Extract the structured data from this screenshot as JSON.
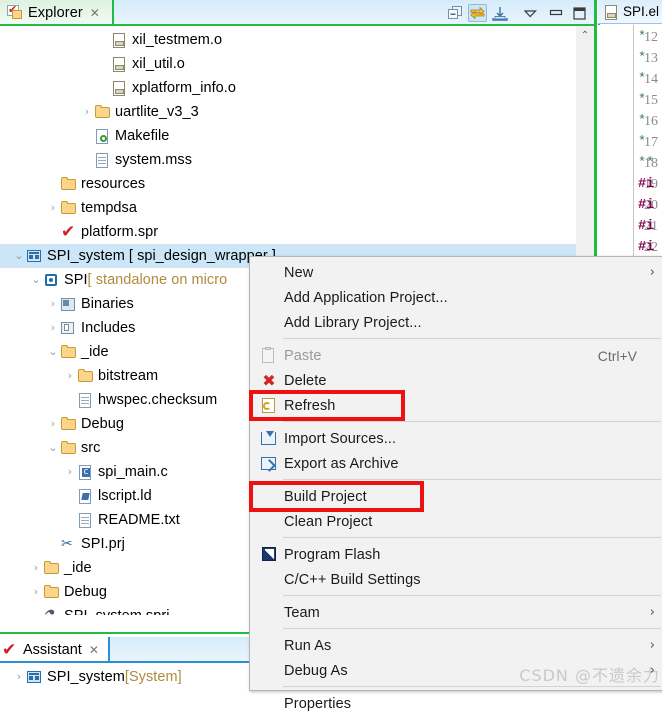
{
  "explorer": {
    "tab_label": "Explorer",
    "tab_close": "✕",
    "tab_icon": "project-explorer-icon",
    "toolbar": [
      {
        "name": "collapse-all-icon",
        "active": false
      },
      {
        "name": "link-with-editor-icon",
        "active": true
      },
      {
        "name": "focus-on-active-task-icon",
        "active": false
      },
      {
        "name": "view-menu-icon",
        "active": false
      },
      {
        "name": "minimize-view-icon",
        "active": false
      },
      {
        "name": "maximize-view-icon",
        "active": false
      }
    ],
    "scroll_up_glyph": "⌃",
    "tree": [
      {
        "label": "xil_testmem.o",
        "indent": 5,
        "arrow": "none",
        "icon": "object-file-icon"
      },
      {
        "label": "xil_util.o",
        "indent": 5,
        "arrow": "none",
        "icon": "object-file-icon"
      },
      {
        "label": "xplatform_info.o",
        "indent": 5,
        "arrow": "none",
        "icon": "object-file-icon"
      },
      {
        "label": "uartlite_v3_3",
        "indent": 4,
        "arrow": "collapsed",
        "icon": "folder-icon"
      },
      {
        "label": "Makefile",
        "indent": 4,
        "arrow": "none",
        "icon": "makefile-icon"
      },
      {
        "label": "system.mss",
        "indent": 4,
        "arrow": "none",
        "icon": "file-icon"
      },
      {
        "label": "resources",
        "indent": 2,
        "arrow": "none",
        "icon": "folder-icon"
      },
      {
        "label": "tempdsa",
        "indent": 2,
        "arrow": "collapsed",
        "icon": "folder-icon"
      },
      {
        "label": "platform.spr",
        "indent": 2,
        "arrow": "none",
        "icon": "spr-icon"
      },
      {
        "label": "SPI_system [ spi_design_wrapper ]",
        "indent": 0,
        "arrow": "expanded",
        "icon": "system-icon",
        "selected": true
      },
      {
        "label": "SPI ",
        "suffix": "[ standalone on micro",
        "indent": 1,
        "arrow": "expanded",
        "icon": "chip-icon"
      },
      {
        "label": "Binaries",
        "indent": 2,
        "arrow": "collapsed",
        "icon": "binaries-icon"
      },
      {
        "label": "Includes",
        "indent": 2,
        "arrow": "collapsed",
        "icon": "includes-icon"
      },
      {
        "label": "_ide",
        "indent": 2,
        "arrow": "expanded",
        "icon": "folder-icon"
      },
      {
        "label": "bitstream",
        "indent": 3,
        "arrow": "collapsed",
        "icon": "folder-icon"
      },
      {
        "label": "hwspec.checksum",
        "indent": 3,
        "arrow": "none",
        "icon": "file-icon"
      },
      {
        "label": "Debug",
        "indent": 2,
        "arrow": "collapsed",
        "icon": "folder-icon"
      },
      {
        "label": "src",
        "indent": 2,
        "arrow": "expanded",
        "icon": "folder-icon"
      },
      {
        "label": "spi_main.c",
        "indent": 3,
        "arrow": "collapsed",
        "icon": "c-source-icon"
      },
      {
        "label": "lscript.ld",
        "indent": 3,
        "arrow": "none",
        "icon": "linker-script-icon"
      },
      {
        "label": "README.txt",
        "indent": 3,
        "arrow": "none",
        "icon": "file-icon"
      },
      {
        "label": "SPI.prj",
        "indent": 2,
        "arrow": "none",
        "icon": "prj-icon"
      },
      {
        "label": "_ide",
        "indent": 1,
        "arrow": "collapsed",
        "icon": "folder-icon"
      },
      {
        "label": "Debug",
        "indent": 1,
        "arrow": "collapsed",
        "icon": "folder-icon"
      },
      {
        "label": "SPI_system.sprj",
        "indent": 1,
        "arrow": "none",
        "icon": "sprj-icon"
      }
    ]
  },
  "assistant": {
    "tab_label": "Assistant",
    "tab_close": "✕",
    "tab_icon": "assistant-icon",
    "rows": [
      {
        "label": "SPI_system ",
        "suffix": "[System]",
        "arrow": "collapsed",
        "icon": "system-icon"
      }
    ]
  },
  "editor": {
    "tab_label": "SPI.el",
    "tab_icon": "elf-file-icon",
    "lines": [
      {
        "num": "12",
        "text": "*",
        "kind": "comment"
      },
      {
        "num": "13",
        "text": "*",
        "kind": "comment"
      },
      {
        "num": "14",
        "text": "*",
        "kind": "comment"
      },
      {
        "num": "15",
        "text": "*",
        "kind": "comment"
      },
      {
        "num": "16",
        "text": "*",
        "kind": "comment"
      },
      {
        "num": "17",
        "text": "*",
        "kind": "comment"
      },
      {
        "num": "18",
        "text": "**",
        "kind": "comment"
      },
      {
        "num": "19",
        "text": "#i",
        "kind": "preprocessor"
      },
      {
        "num": "20",
        "text": "#i",
        "kind": "preprocessor"
      },
      {
        "num": "21",
        "text": "#i",
        "kind": "preprocessor"
      },
      {
        "num": "22",
        "text": "#i",
        "kind": "preprocessor"
      }
    ]
  },
  "context_menu": {
    "items": [
      {
        "label": "New",
        "icon": null,
        "submenu": "›",
        "disabled": false,
        "shortcut": null
      },
      {
        "label": "Add Application Project...",
        "icon": null,
        "submenu": null,
        "disabled": false,
        "shortcut": null
      },
      {
        "label": "Add Library Project...",
        "icon": null,
        "submenu": null,
        "disabled": false,
        "shortcut": null
      },
      {
        "label": "Paste",
        "icon": "paste-icon",
        "submenu": null,
        "disabled": true,
        "shortcut": "Ctrl+V"
      },
      {
        "label": "Delete",
        "icon": "delete-icon",
        "submenu": null,
        "disabled": false,
        "shortcut": null
      },
      {
        "label": "Refresh",
        "icon": "refresh-icon",
        "submenu": null,
        "disabled": false,
        "shortcut": null
      },
      {
        "label": "Import Sources...",
        "icon": "import-icon",
        "submenu": null,
        "disabled": false,
        "shortcut": null
      },
      {
        "label": "Export as Archive",
        "icon": "export-icon",
        "submenu": null,
        "disabled": false,
        "shortcut": null
      },
      {
        "label": "Build Project",
        "icon": null,
        "submenu": null,
        "disabled": false,
        "shortcut": null
      },
      {
        "label": "Clean Project",
        "icon": null,
        "submenu": null,
        "disabled": false,
        "shortcut": null
      },
      {
        "label": "Program Flash",
        "icon": "flash-icon",
        "submenu": null,
        "disabled": false,
        "shortcut": null
      },
      {
        "label": "C/C++ Build Settings",
        "icon": null,
        "submenu": null,
        "disabled": false,
        "shortcut": null
      },
      {
        "label": "Team",
        "icon": null,
        "submenu": "›",
        "disabled": false,
        "shortcut": null
      },
      {
        "label": "Run As",
        "icon": null,
        "submenu": "›",
        "disabled": false,
        "shortcut": null
      },
      {
        "label": "Debug As",
        "icon": null,
        "submenu": "›",
        "disabled": false,
        "shortcut": null
      },
      {
        "label": "Properties",
        "icon": null,
        "submenu": null,
        "disabled": false,
        "shortcut": null
      }
    ],
    "highlights": [
      "Refresh",
      "Build Project"
    ],
    "highlight_color": "#ee1111"
  },
  "watermark": "CSDN @不遗余力"
}
